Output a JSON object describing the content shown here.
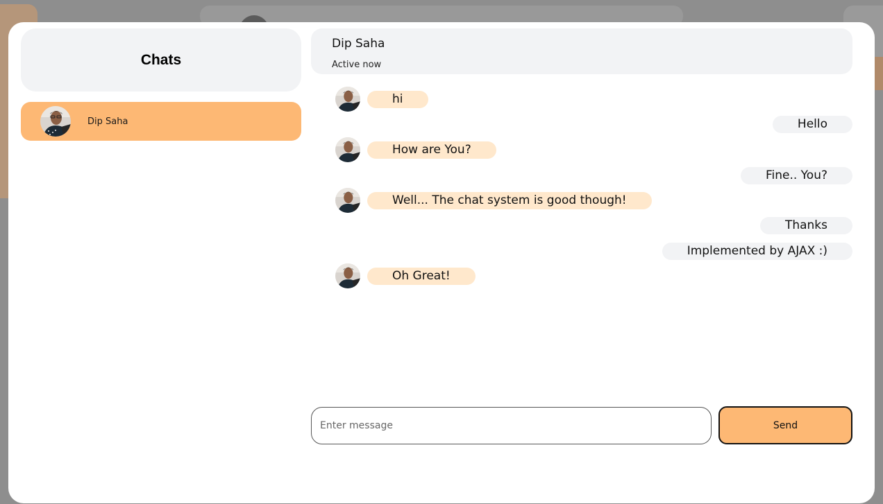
{
  "sidebar": {
    "title": "Chats",
    "contacts": [
      {
        "name": "Dip Saha",
        "active": true
      }
    ]
  },
  "conversation": {
    "contact_name": "Dip Saha",
    "status": "Active now",
    "messages": [
      {
        "from": "contact",
        "text": "hi"
      },
      {
        "from": "me",
        "text": "Hello"
      },
      {
        "from": "contact",
        "text": "How are You?"
      },
      {
        "from": "me",
        "text": "Fine.. You?"
      },
      {
        "from": "contact",
        "text": "Well... The chat system is good though!"
      },
      {
        "from": "me",
        "text": "Thanks"
      },
      {
        "from": "me",
        "text": "Implemented by AJAX :)"
      },
      {
        "from": "contact",
        "text": "Oh Great!"
      }
    ]
  },
  "composer": {
    "placeholder": "Enter message",
    "value": "",
    "send_label": "Send"
  },
  "colors": {
    "accent": "#fdb874",
    "incoming_bubble": "#ffe8cc",
    "outgoing_bubble": "#f2f3f5",
    "overlay": "#8e8e8e"
  }
}
